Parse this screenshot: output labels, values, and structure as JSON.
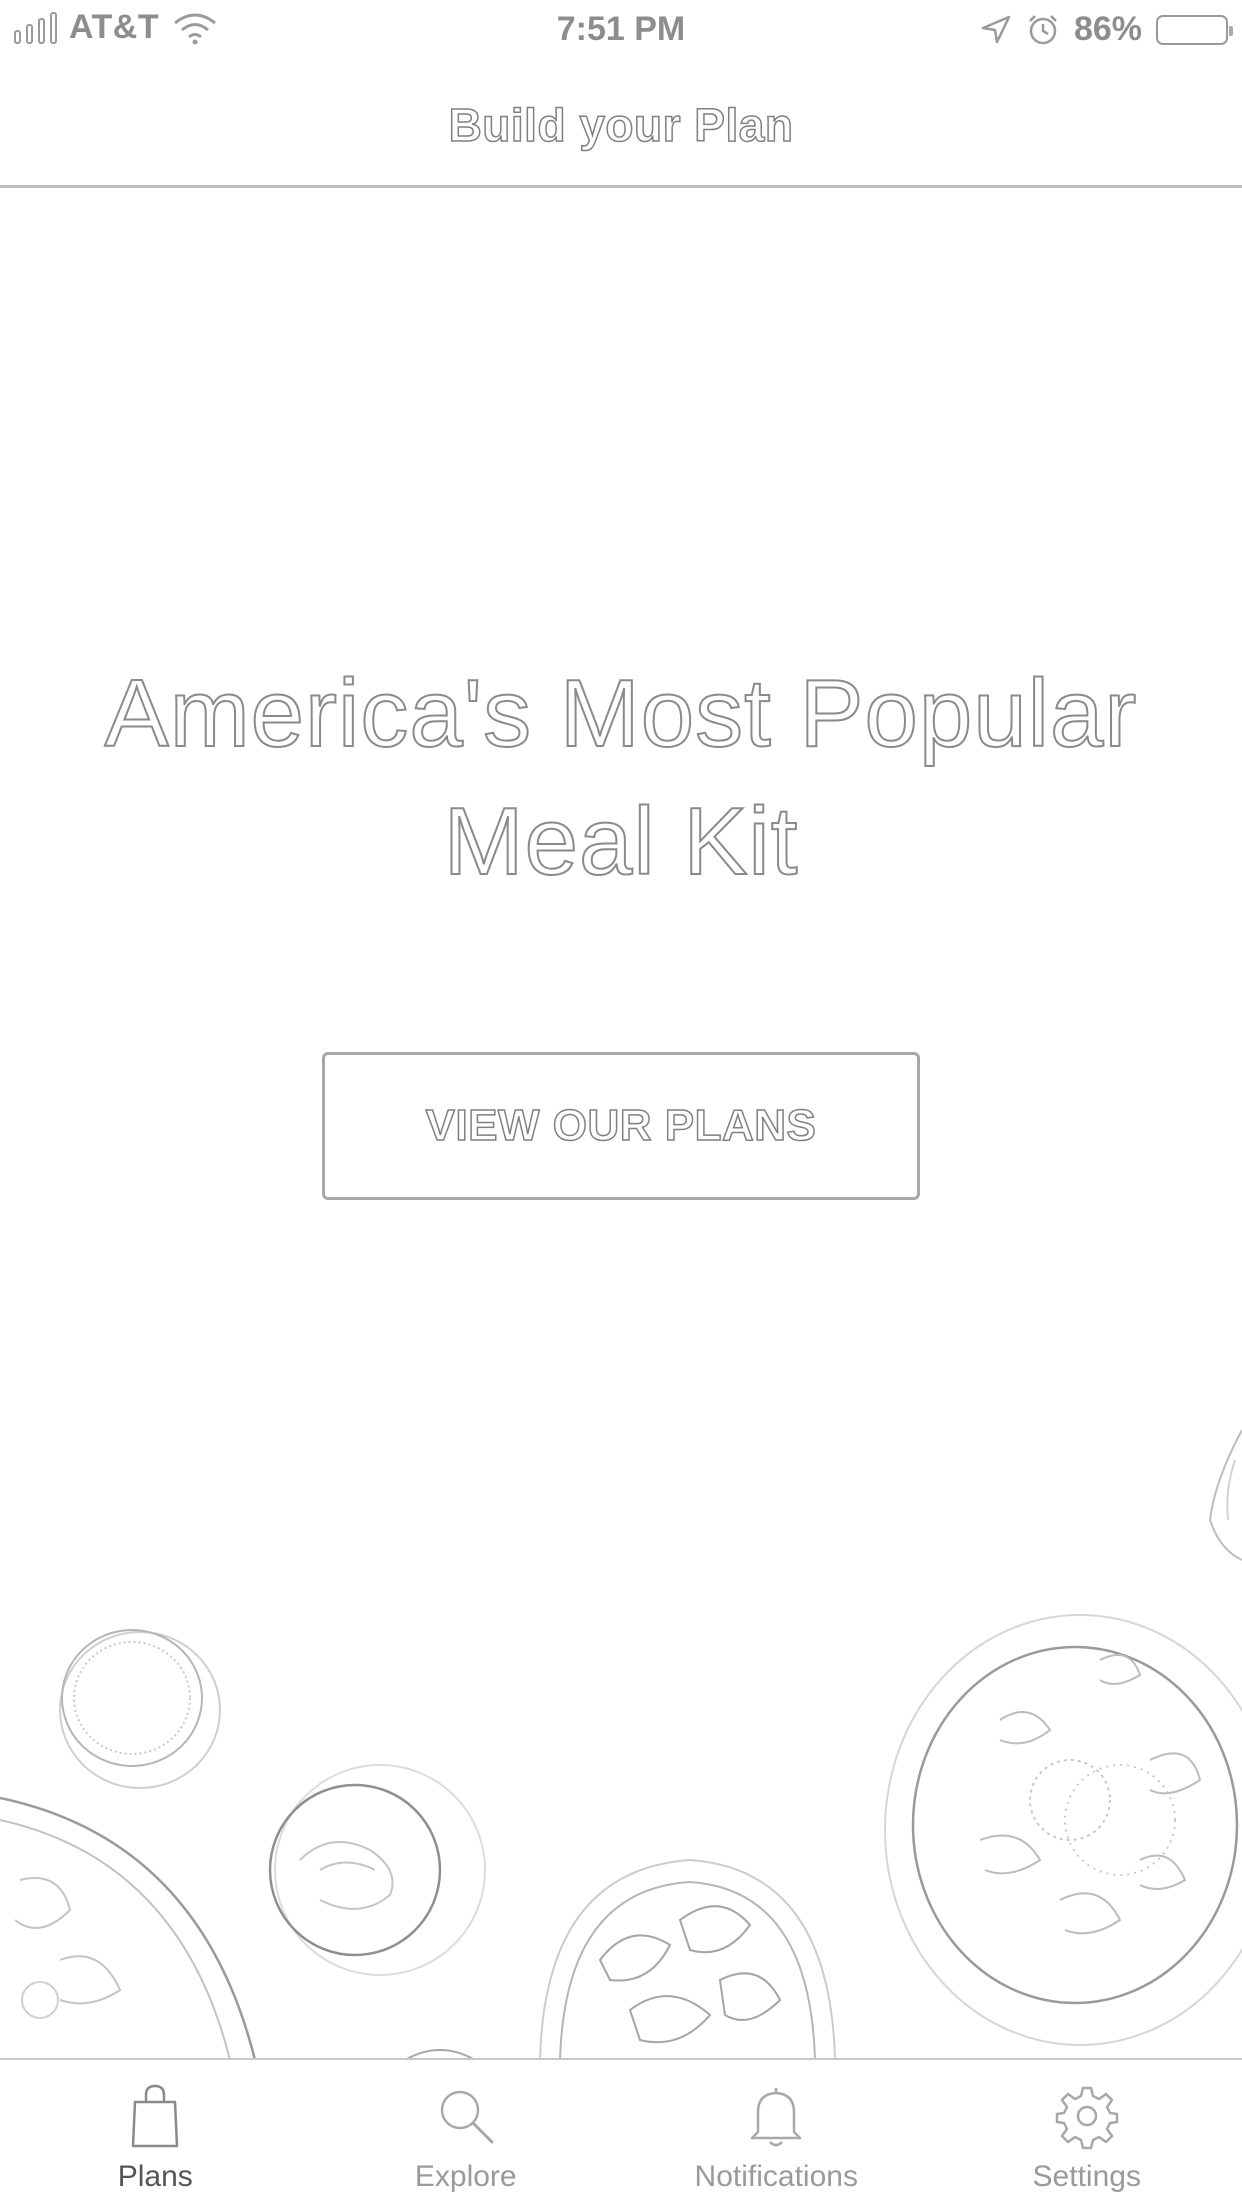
{
  "status_bar": {
    "carrier": "AT&T",
    "time": "7:51 PM",
    "battery_percent": "86%",
    "signal_bars_filled": 1,
    "signal_bars_total": 4,
    "icons": [
      "signal-icon",
      "wifi-icon",
      "location-arrow-icon",
      "alarm-icon",
      "battery-icon"
    ]
  },
  "header": {
    "title": "Build your Plan"
  },
  "hero": {
    "headline_line1": "America's Most Popular",
    "headline_line2": "Meal Kit",
    "cta_label": "VIEW OUR PLANS"
  },
  "tab_bar": {
    "tabs": [
      {
        "label": "Plans",
        "icon": "shopping-bag-icon",
        "active": true
      },
      {
        "label": "Explore",
        "icon": "search-icon",
        "active": false
      },
      {
        "label": "Notifications",
        "icon": "bell-icon",
        "active": false
      },
      {
        "label": "Settings",
        "icon": "gear-icon",
        "active": false
      }
    ]
  },
  "colors": {
    "background": "#ffffff",
    "outline": "#8a8a8a",
    "divider": "#bdbdbd"
  }
}
